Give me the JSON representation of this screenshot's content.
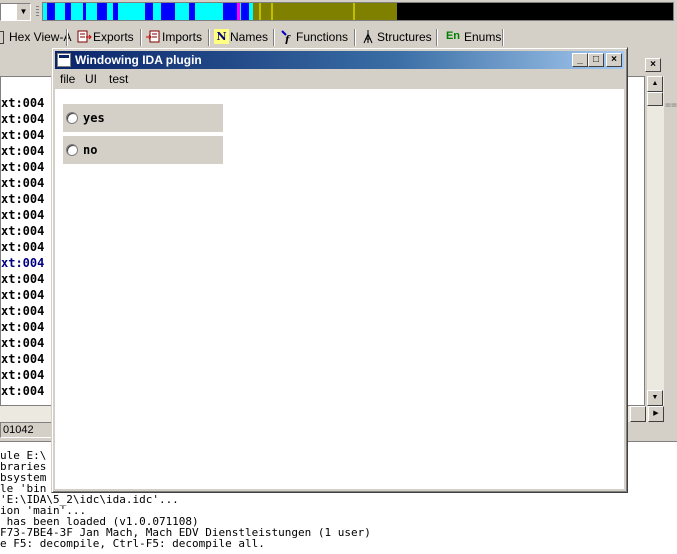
{
  "tabs": [
    {
      "label": "Hex View-A",
      "icon": "hex-view-icon"
    },
    {
      "label": "Exports",
      "icon": "exports-icon"
    },
    {
      "label": "Imports",
      "icon": "imports-icon"
    },
    {
      "label": "Names",
      "icon": "names-icon",
      "glyph": "N"
    },
    {
      "label": "Functions",
      "icon": "functions-icon"
    },
    {
      "label": "Structures",
      "icon": "structures-icon"
    },
    {
      "label": "Enums",
      "icon": "enums-icon",
      "glyph": "En"
    }
  ],
  "disassembly": {
    "lines": [
      "xt:004",
      "xt:004",
      "xt:004",
      "xt:004",
      "xt:004",
      "xt:004",
      "xt:004",
      "xt:004",
      "xt:004",
      "xt:004",
      "xt:004",
      "xt:004",
      "xt:004",
      "xt:004",
      "xt:004",
      "xt:004",
      "xt:004",
      "xt:004",
      "xt:004"
    ],
    "highlight_index": 10,
    "right_pane_fragment": "=="
  },
  "status": {
    "address": "01042"
  },
  "messages": [
    "ule E:\\",
    "braries",
    "bsystem",
    "le 'bin",
    "'E:\\IDA\\5_2\\idc\\ida.idc'...",
    "ion 'main'...",
    " has been loaded (v1.0.071108)",
    "F73-7BE4-3F Jan Mach, Mach EDV Dienstleistungen (1 user)",
    "e F5: decompile, Ctrl-F5: decompile all."
  ],
  "plugin": {
    "title": "Windowing IDA plugin",
    "menu": [
      "file",
      "UI",
      "test"
    ],
    "radios": [
      "yes",
      "no"
    ]
  },
  "colors": {
    "title_start": "#0a246a",
    "title_end": "#a6caf0",
    "nav_cyan": "#00ffff",
    "nav_blue": "#0000ff",
    "nav_olive": "#808000",
    "highlight_text": "#000080"
  }
}
